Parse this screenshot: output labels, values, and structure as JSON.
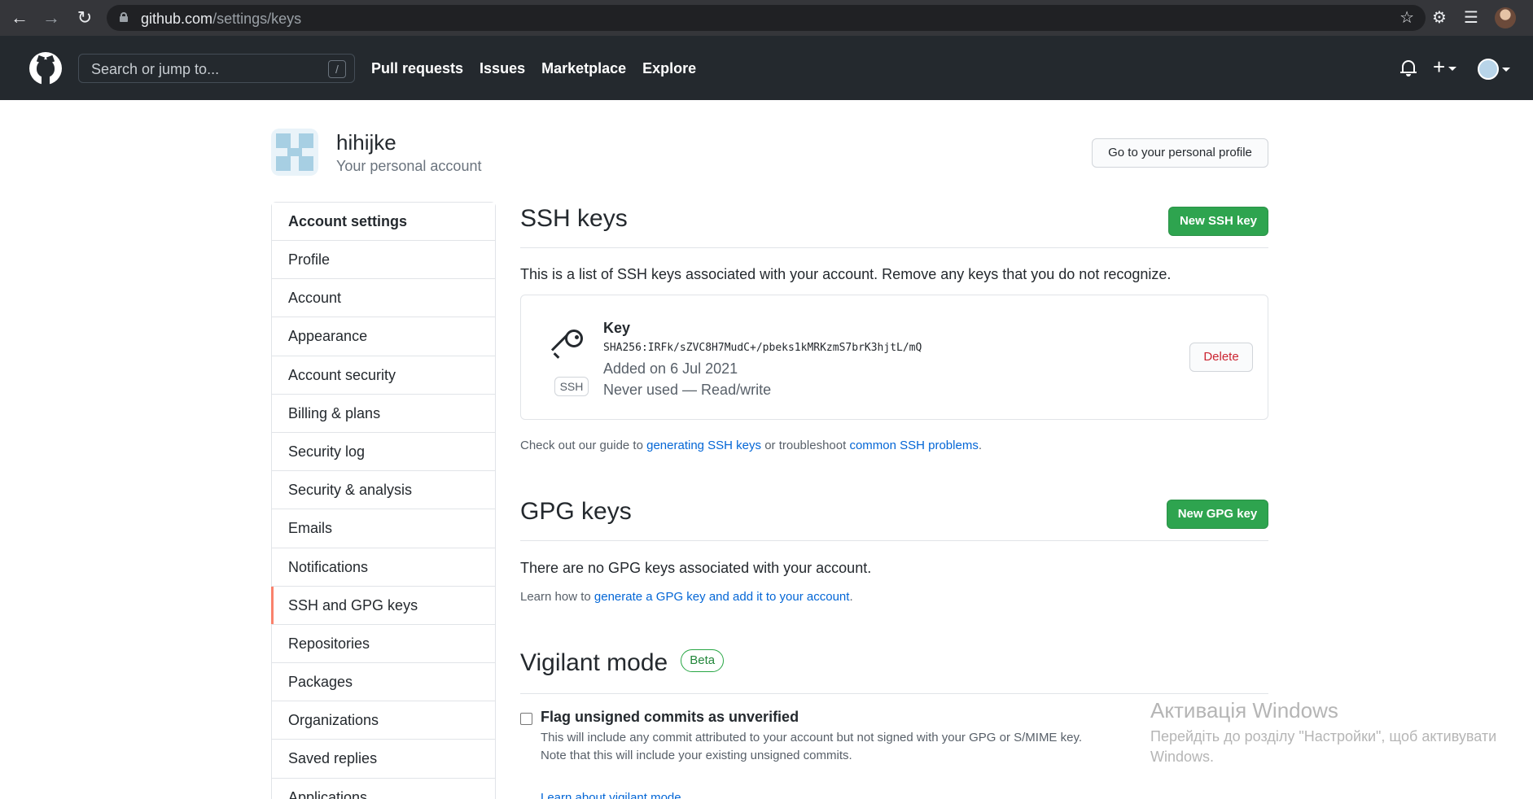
{
  "browser": {
    "url_host": "github.com",
    "url_path": "/settings/keys"
  },
  "header": {
    "search_placeholder": "Search or jump to...",
    "search_shortcut": "/",
    "nav": [
      "Pull requests",
      "Issues",
      "Marketplace",
      "Explore"
    ]
  },
  "account": {
    "name": "hihijke",
    "subtitle": "Your personal account",
    "profile_button": "Go to your personal profile"
  },
  "sidebar": {
    "heading": "Account settings",
    "items": [
      "Profile",
      "Account",
      "Appearance",
      "Account security",
      "Billing & plans",
      "Security log",
      "Security & analysis",
      "Emails",
      "Notifications",
      "SSH and GPG keys",
      "Repositories",
      "Packages",
      "Organizations",
      "Saved replies",
      "Applications"
    ],
    "selected": "SSH and GPG keys"
  },
  "ssh": {
    "title": "SSH keys",
    "new_button": "New SSH key",
    "description": "This is a list of SSH keys associated with your account. Remove any keys that you do not recognize.",
    "key": {
      "badge": "SSH",
      "title": "Key",
      "fingerprint": "SHA256:IRFk/sZVC8H7MudC+/pbeks1kMRKzmS7brK3hjtL/mQ",
      "added": "Added on 6 Jul 2021",
      "usage": "Never used — Read/write",
      "delete_button": "Delete"
    },
    "guide_prefix": "Check out our guide to ",
    "guide_link": "generating SSH keys",
    "guide_middle": " or troubleshoot ",
    "problems_link": "common SSH problems",
    "guide_suffix": "."
  },
  "gpg": {
    "title": "GPG keys",
    "new_button": "New GPG key",
    "empty_text": "There are no GPG keys associated with your account.",
    "learn_prefix": "Learn how to ",
    "learn_link": "generate a GPG key and add it to your account",
    "learn_suffix": "."
  },
  "vigilant": {
    "title": "Vigilant mode",
    "badge": "Beta",
    "checkbox_label": "Flag unsigned commits as unverified",
    "note_line1": "This will include any commit attributed to your account but not signed with your GPG or S/MIME key.",
    "note_line2": "Note that this will include your existing unsigned commits.",
    "link": "Learn about vigilant mode",
    "link_suffix": "."
  },
  "watermark": {
    "title": "Активація Windows",
    "line1": "Перейдіть до розділу \"Настройки\", щоб активувати",
    "line2": "Windows."
  },
  "colors": {
    "header_bg": "#24292e",
    "primary_green": "#2ea44f",
    "link_blue": "#0366d6",
    "danger_red": "#cb2431",
    "selected_accent": "#f9826c"
  }
}
